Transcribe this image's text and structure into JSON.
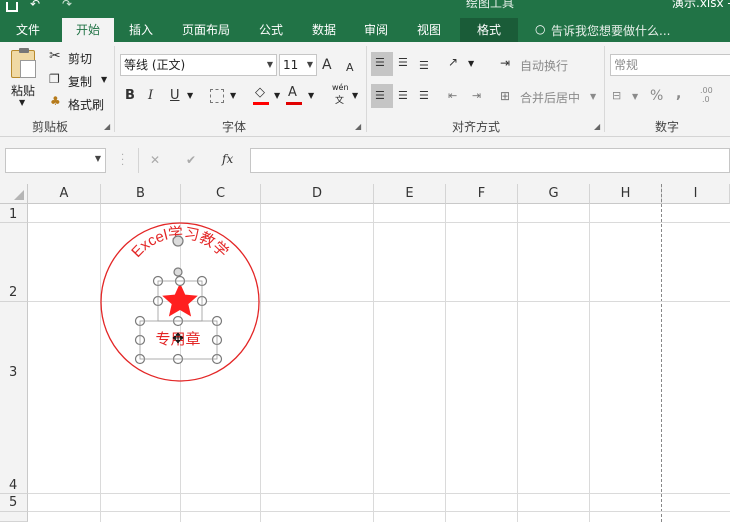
{
  "titlebar": {
    "context_title": "绘图工具",
    "filename": "演示.xlsx -"
  },
  "tabs": [
    {
      "label": "文件"
    },
    {
      "label": "开始"
    },
    {
      "label": "插入"
    },
    {
      "label": "页面布局"
    },
    {
      "label": "公式"
    },
    {
      "label": "数据"
    },
    {
      "label": "审阅"
    },
    {
      "label": "视图"
    },
    {
      "label": "格式"
    }
  ],
  "tell_me": "告诉我您想要做什么...",
  "clipboard": {
    "paste": "粘贴",
    "cut": "剪切",
    "copy": "复制",
    "format_painter": "格式刷",
    "group": "剪贴板"
  },
  "font": {
    "name": "等线 (正文)",
    "size": "11",
    "group": "字体",
    "bold": "B",
    "italic": "I",
    "underline": "U",
    "grow": "A",
    "shrink": "A",
    "phonetic": "wén",
    "phonetic_char": "文"
  },
  "alignment": {
    "wrap": "自动换行",
    "merge": "合并后居中",
    "group": "对齐方式"
  },
  "number": {
    "format": "常规",
    "group": "数字",
    "percent": "%",
    "comma": ",",
    "dec_inc": ".00",
    "dec_dec": ".0"
  },
  "formula_bar": {
    "cancel": "✕",
    "enter": "✔",
    "fx": "fx",
    "value": ""
  },
  "columns": [
    "A",
    "B",
    "C",
    "D",
    "E",
    "F",
    "G",
    "H",
    "I"
  ],
  "rows": [
    "1",
    "2",
    "3",
    "4",
    "5"
  ],
  "seal": {
    "arc_text": "Excel学习教学",
    "bottom_text": "专用章",
    "color": "#e32626"
  },
  "colors": {
    "brand": "#217346",
    "font_color": "#e00000",
    "fill_color": "#ff0000"
  }
}
